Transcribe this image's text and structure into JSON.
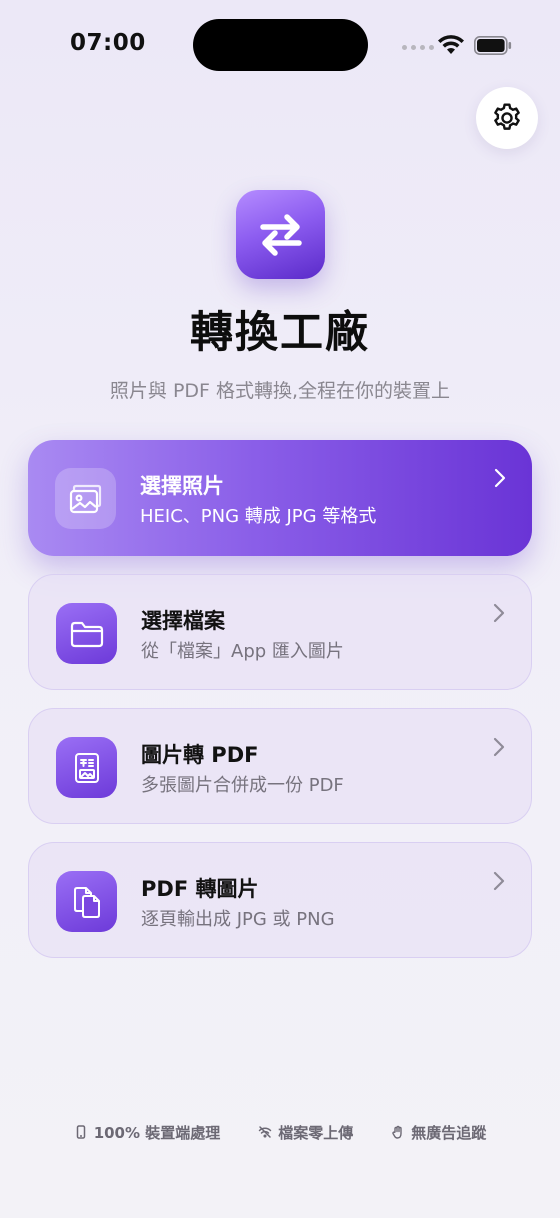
{
  "status_bar": {
    "time": "07:00",
    "icons": [
      "signal-dots-icon",
      "wifi-icon",
      "battery-icon"
    ]
  },
  "header": {
    "settings_icon": "gear-icon",
    "app_icon": "swap-arrows-icon",
    "title": "轉換工廠",
    "subtitle": "照片與 PDF 格式轉換,全程在你的裝置上"
  },
  "actions": [
    {
      "title": "選擇照片",
      "subtitle": "HEIC、PNG 轉成 JPG 等格式",
      "icon": "photos-icon",
      "highlighted": true
    },
    {
      "title": "選擇檔案",
      "subtitle": "從「檔案」App 匯入圖片",
      "icon": "folder-icon",
      "highlighted": false
    },
    {
      "title": "圖片轉 PDF",
      "subtitle": "多張圖片合併成一份 PDF",
      "icon": "image-to-pdf-icon",
      "highlighted": false
    },
    {
      "title": "PDF 轉圖片",
      "subtitle": "逐頁輸出成 JPG 或 PNG",
      "icon": "documents-icon",
      "highlighted": false
    }
  ],
  "footer": [
    {
      "label": "100% 裝置端處理",
      "icon": "phone-icon"
    },
    {
      "label": "檔案零上傳",
      "icon": "wifi-off-icon"
    },
    {
      "label": "無廣告追蹤",
      "icon": "hand-icon"
    }
  ],
  "colors": {
    "accent": "#7b4be3",
    "accent_light": "#a98af2",
    "background": "#eeebf7",
    "card_background": "#e8e2f6",
    "card_border": "#d9cff2"
  }
}
